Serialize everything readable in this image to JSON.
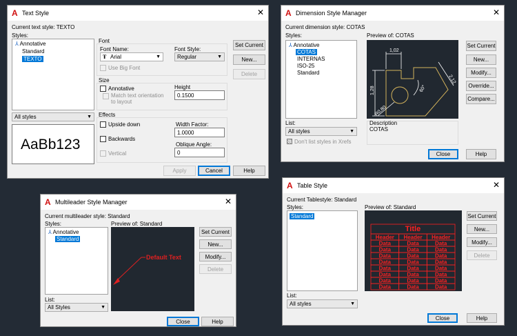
{
  "text_style": {
    "title": "Text Style",
    "current_label": "Current text style:  TEXTO",
    "styles_label": "Styles:",
    "styles": [
      {
        "label": "Annotative",
        "annotative": true,
        "selected": false
      },
      {
        "label": "Standard",
        "annotative": false,
        "selected": false
      },
      {
        "label": "TEXTO",
        "annotative": false,
        "selected": true
      }
    ],
    "filter": "All styles",
    "preview_text": "AaBb123",
    "font_group": "Font",
    "font_name_label": "Font Name:",
    "font_name": "Arial",
    "font_style_label": "Font Style:",
    "font_style": "Regular",
    "use_big_font": "Use Big Font",
    "size_group": "Size",
    "annotative": "Annotative",
    "match_orientation": "Match text orientation\nto layout",
    "height_label": "Height",
    "height": "0.1500",
    "effects_group": "Effects",
    "upside_down": "Upside down",
    "backwards": "Backwards",
    "vertical": "Vertical",
    "width_factor_label": "Width Factor:",
    "width_factor": "1.0000",
    "oblique_label": "Oblique Angle:",
    "oblique": "0",
    "set_current": "Set Current",
    "new": "New...",
    "delete": "Delete",
    "apply": "Apply",
    "cancel": "Cancel",
    "help": "Help"
  },
  "dim_style": {
    "title": "Dimension Style Manager",
    "current_label": "Current dimension style: COTAS",
    "styles_label": "Styles:",
    "styles": [
      {
        "label": "Annotative",
        "annotative": true,
        "selected": false
      },
      {
        "label": "COTAS",
        "annotative": false,
        "selected": true
      },
      {
        "label": "INTERNAS",
        "annotative": false,
        "selected": false
      },
      {
        "label": "ISO-25",
        "annotative": false,
        "selected": false
      },
      {
        "label": "Standard",
        "annotative": false,
        "selected": false
      }
    ],
    "preview_label": "Preview of: COTAS",
    "preview_dims": {
      "top": "1,02",
      "left": "1,28",
      "right": "2,12",
      "angle": "60°",
      "radius": "R0,80"
    },
    "list_label": "List:",
    "list_value": "All styles",
    "dont_list": "Don't list styles in Xrefs",
    "description_label": "Description",
    "description": "COTAS",
    "set_current": "Set Current",
    "new": "New...",
    "modify": "Modify...",
    "override": "Override...",
    "compare": "Compare...",
    "close": "Close",
    "help": "Help"
  },
  "mleader_style": {
    "title": "Multileader Style Manager",
    "current_label": "Current multileader style: Standard",
    "styles_label": "Styles:",
    "styles": [
      {
        "label": "Annotative",
        "annotative": true,
        "selected": false
      },
      {
        "label": "Standard",
        "annotative": false,
        "selected": true
      }
    ],
    "preview_label": "Preview of: Standard",
    "preview_text": "Default Text",
    "list_label": "List:",
    "list_value": "All Styles",
    "set_current": "Set Current",
    "new": "New...",
    "modify": "Modify...",
    "delete": "Delete",
    "close": "Close",
    "help": "Help"
  },
  "table_style": {
    "title": "Table Style",
    "current_label": "Current Tablestyle: Standard",
    "styles_label": "Styles:",
    "styles": [
      {
        "label": "Standard",
        "annotative": false,
        "selected": true
      }
    ],
    "preview_label": "Preview of: Standard",
    "table_title": "Title",
    "header": "Header",
    "data": "Data",
    "list_label": "List:",
    "list_value": "All styles",
    "set_current": "Set Current",
    "new": "New...",
    "modify": "Modify...",
    "delete": "Delete",
    "close": "Close",
    "help": "Help"
  },
  "colors": {
    "desktop": "#232b35",
    "selection": "#0078d7",
    "preview_bg": "#212830",
    "dim_line": "#d4b35b",
    "table_red": "#ff2020",
    "arrow_red": "#e02020"
  }
}
